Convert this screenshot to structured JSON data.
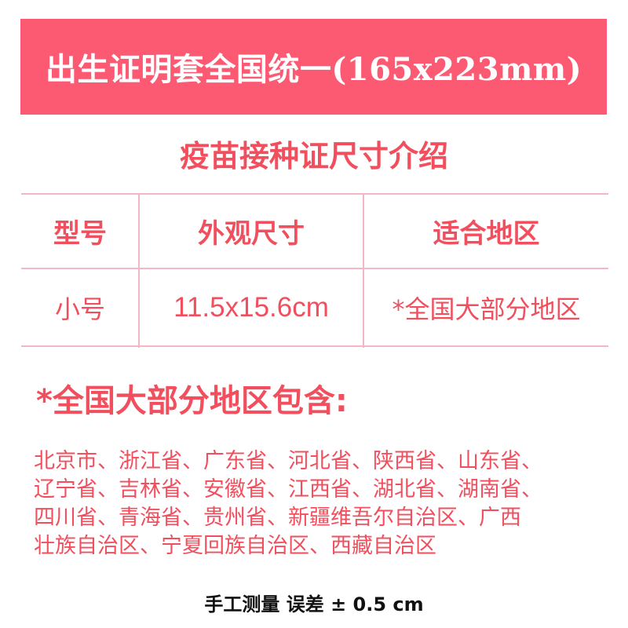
{
  "banner": {
    "title": "出生证明套全国统一(165x223mm)",
    "background": "#fc5a73"
  },
  "subtitle": "疫苗接种证尺寸介绍",
  "table": {
    "headers": [
      "型号",
      "外观尺寸",
      "适合地区"
    ],
    "rows": [
      [
        "小号",
        "11.5x15.6cm",
        "*全国大部分地区"
      ]
    ],
    "line_color": "#f3b7c5"
  },
  "regions": {
    "heading": "*全国大部分地区包含:",
    "lines": [
      "北京市、浙江省、广东省、河北省、陕西省、山东省、",
      "辽宁省、吉林省、安徽省、江西省、湖北省、湖南省、",
      "四川省、青海省、贵州省、新疆维吾尔自治区、广西",
      "壮族自治区、宁夏回族自治区、西藏自治区"
    ]
  },
  "footer_note": "手工测量  误差 ± 0.5 cm",
  "colors": {
    "accent": "#f24f5e",
    "text_dark": "#111111"
  }
}
